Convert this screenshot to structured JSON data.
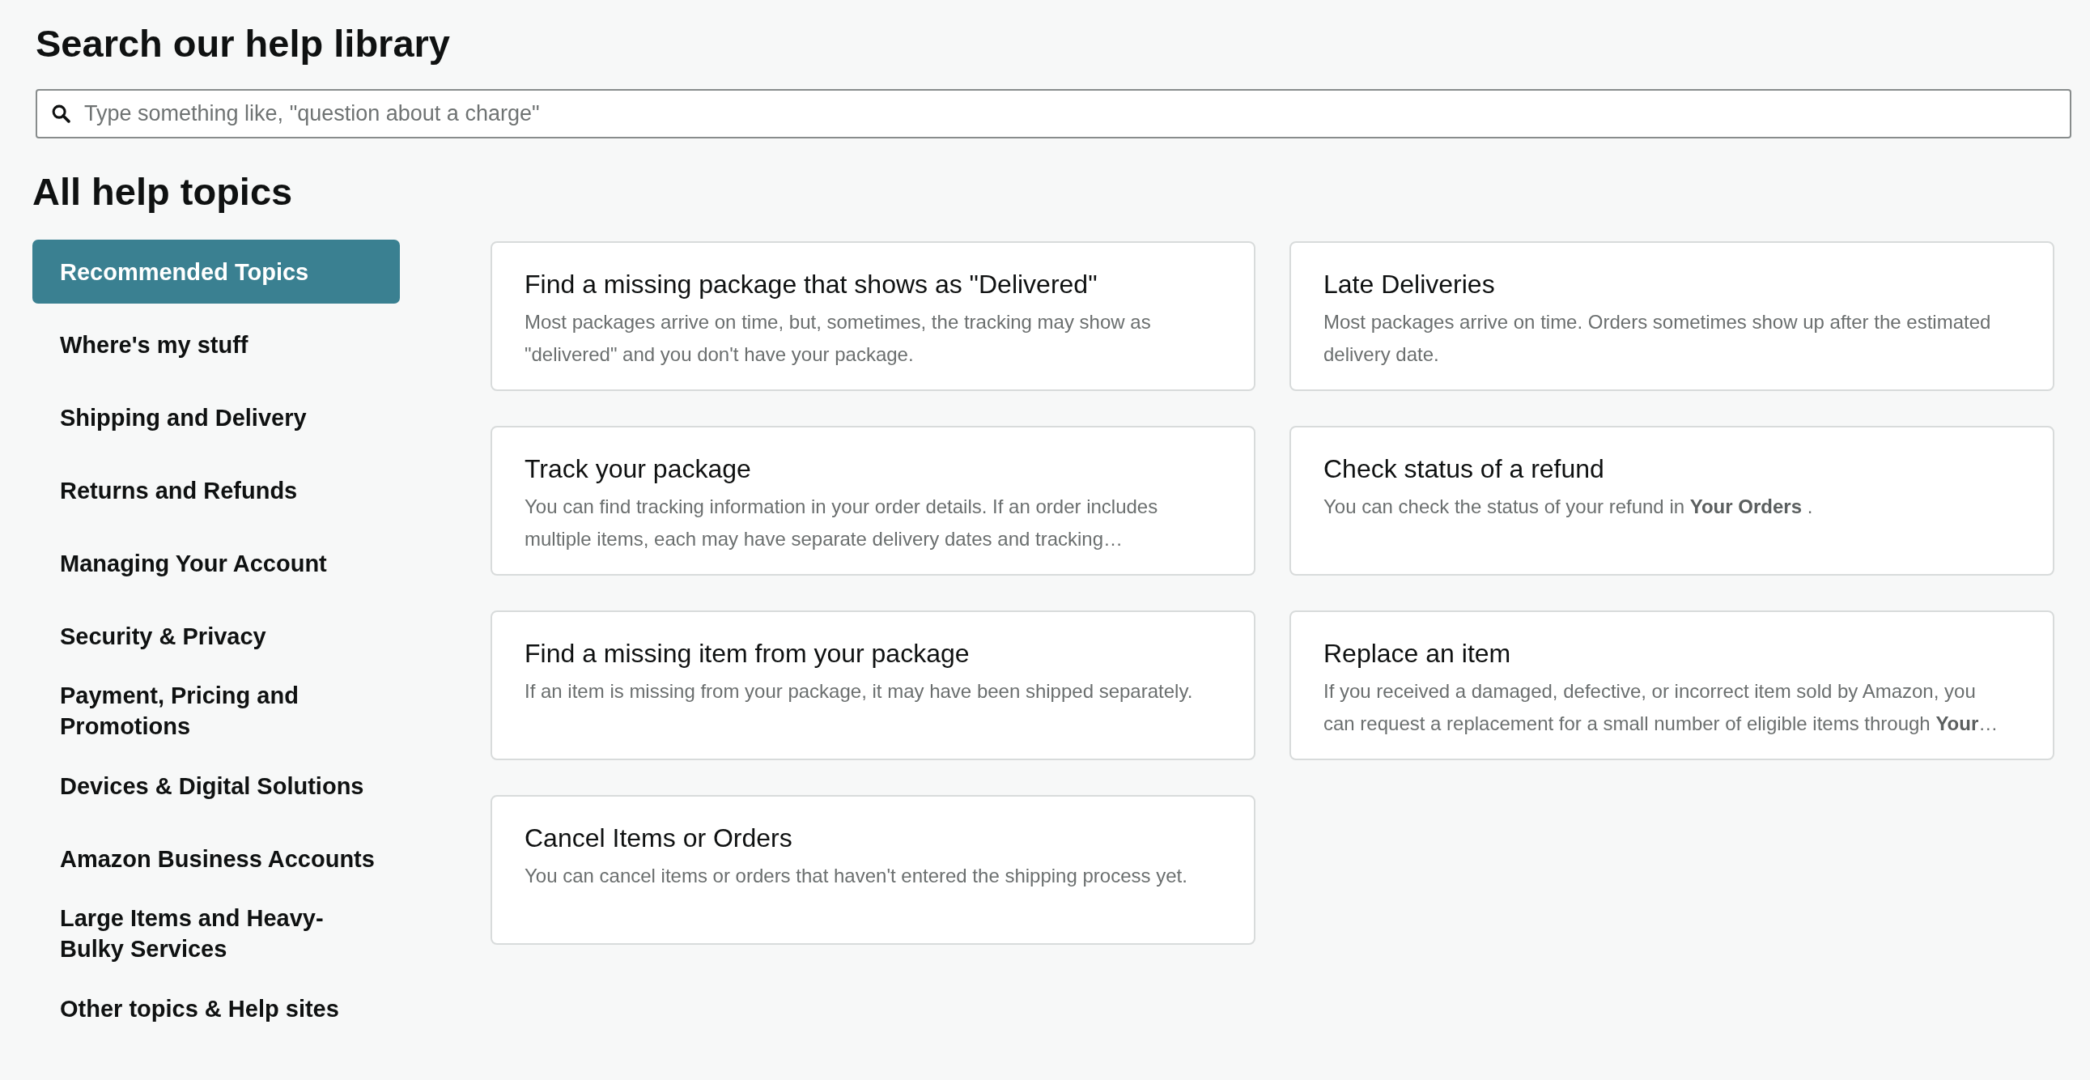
{
  "search": {
    "title": "Search our help library",
    "placeholder": "Type something like, \"question about a charge\""
  },
  "topics": {
    "title": "All help topics",
    "sidebar": {
      "items": [
        {
          "label": "Recommended Topics",
          "selected": true
        },
        {
          "label": "Where's my stuff",
          "selected": false
        },
        {
          "label": "Shipping and Delivery",
          "selected": false
        },
        {
          "label": "Returns and Refunds",
          "selected": false
        },
        {
          "label": "Managing Your Account",
          "selected": false
        },
        {
          "label": "Security & Privacy",
          "selected": false
        },
        {
          "label": "Payment, Pricing and Promotions",
          "selected": false
        },
        {
          "label": "Devices & Digital Solutions",
          "selected": false
        },
        {
          "label": "Amazon Business Accounts",
          "selected": false
        },
        {
          "label": "Large Items and Heavy-Bulky Services",
          "selected": false
        },
        {
          "label": "Other topics & Help sites",
          "selected": false
        }
      ]
    },
    "cards": [
      {
        "title": "Find a missing package that shows as \"Delivered\"",
        "description": "Most packages arrive on time, but, sometimes, the tracking may show as \"delivered\" and you don't have your package."
      },
      {
        "title": "Late Deliveries",
        "description": "Most packages arrive on time. Orders sometimes show up after the estimated delivery date."
      },
      {
        "title": "Track your package",
        "description": "You can find tracking information in your order details. If an order includes multiple items, each may have separate delivery dates and tracking…"
      },
      {
        "title": "Check status of a refund",
        "description": "You can check the status of your refund in **Your Orders** ."
      },
      {
        "title": "Find a missing item from your package",
        "description": "If an item is missing from your package, it may have been shipped separately."
      },
      {
        "title": "Replace an item",
        "description": "If you received a damaged, defective, or incorrect item sold by Amazon, you can request a replacement for a small number of eligible items through **Your**…"
      },
      {
        "title": "Cancel Items or Orders",
        "description": "You can cancel items or orders that haven't entered the shipping process yet."
      }
    ]
  }
}
